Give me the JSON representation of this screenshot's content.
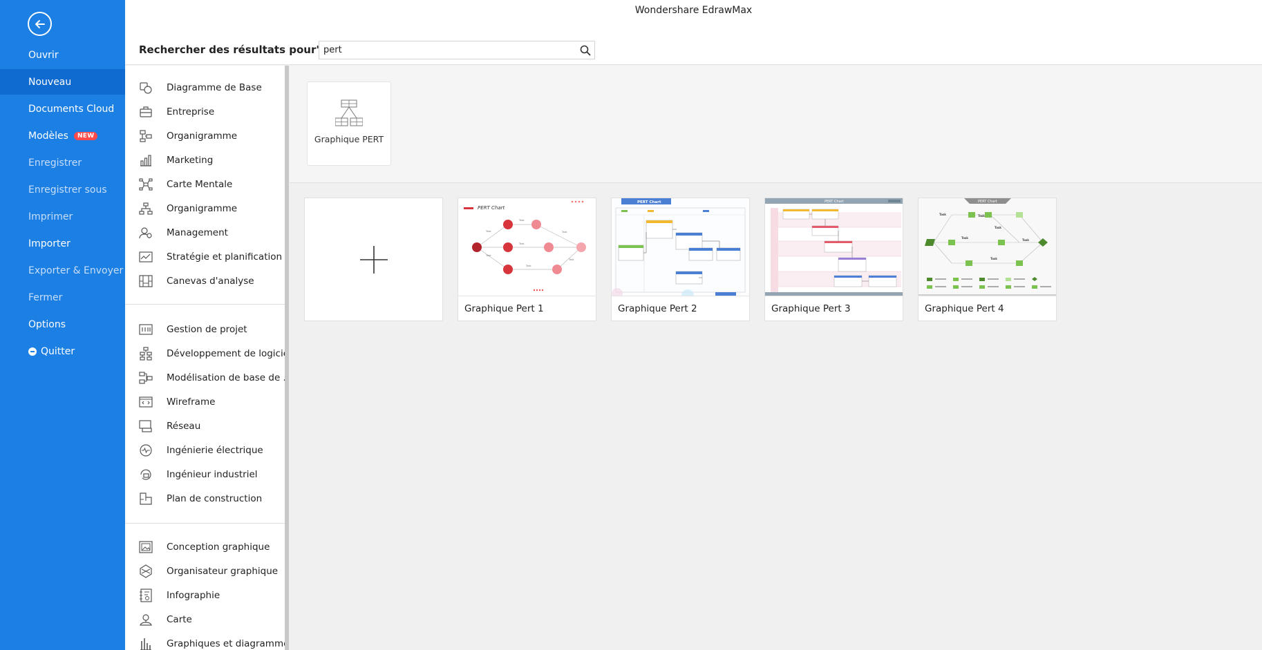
{
  "app": {
    "title": "Wondershare EdrawMax"
  },
  "sidebar": {
    "items": [
      {
        "label": "Ouvrir"
      },
      {
        "label": "Nouveau"
      },
      {
        "label": "Documents Cloud"
      },
      {
        "label": "Modèles",
        "badge": "NEW"
      },
      {
        "label": "Enregistrer"
      },
      {
        "label": "Enregistrer sous"
      },
      {
        "label": "Imprimer"
      },
      {
        "label": "Importer"
      },
      {
        "label": "Exporter & Envoyer"
      },
      {
        "label": "Fermer"
      },
      {
        "label": "Options"
      },
      {
        "label": "Quitter"
      }
    ],
    "active": "Nouveau",
    "colors": {
      "background": "#1b7fe3",
      "active": "#0f6bd0",
      "badge": "#ff4a4a"
    }
  },
  "search": {
    "label": "Rechercher des résultats pour\"pert\"",
    "value": "pert",
    "placeholder": ""
  },
  "categories": {
    "group1": [
      {
        "label": "Diagramme de Base",
        "icon": "basic-diagram-icon"
      },
      {
        "label": "Entreprise",
        "icon": "briefcase-icon"
      },
      {
        "label": "Organigramme",
        "icon": "flowchart-icon"
      },
      {
        "label": "Marketing",
        "icon": "bar-chart-icon"
      },
      {
        "label": "Carte Mentale",
        "icon": "mind-map-icon"
      },
      {
        "label": "Organigramme",
        "icon": "org-chart-icon"
      },
      {
        "label": "Management",
        "icon": "management-icon"
      },
      {
        "label": "Stratégie et planification",
        "icon": "strategy-icon"
      },
      {
        "label": "Canevas d'analyse",
        "icon": "canvas-icon"
      }
    ],
    "group2": [
      {
        "label": "Gestion de projet",
        "icon": "project-icon"
      },
      {
        "label": "Développement de logiciels",
        "icon": "software-icon"
      },
      {
        "label": "Modélisation de base de ...",
        "icon": "database-icon"
      },
      {
        "label": "Wireframe",
        "icon": "wireframe-icon"
      },
      {
        "label": "Réseau",
        "icon": "network-icon"
      },
      {
        "label": "Ingénierie électrique",
        "icon": "electric-icon"
      },
      {
        "label": "Ingénieur industriel",
        "icon": "industrial-icon"
      },
      {
        "label": "Plan de construction",
        "icon": "floorplan-icon"
      }
    ],
    "group3": [
      {
        "label": "Conception graphique",
        "icon": "graphic-design-icon"
      },
      {
        "label": "Organisateur graphique",
        "icon": "organizer-icon"
      },
      {
        "label": "Infographie",
        "icon": "infographic-icon"
      },
      {
        "label": "Carte",
        "icon": "map-pin-icon"
      },
      {
        "label": "Graphiques et diagrammes",
        "icon": "charts-icon"
      }
    ]
  },
  "diagram_type": {
    "label": "Graphique PERT"
  },
  "templates": [
    {
      "name": "Graphique Pert 1"
    },
    {
      "name": "Graphique Pert 2"
    },
    {
      "name": "Graphique Pert 3"
    },
    {
      "name": "Graphique Pert 4"
    }
  ],
  "thumbnails": {
    "pert1": {
      "title": "PERT Chart",
      "node_label": "Task",
      "accent": "#d8343c"
    },
    "pert2": {
      "title": "PERT Chart",
      "accent": "#4a7fd4"
    },
    "pert3": {
      "title": "PERT Chart",
      "accent": "#93a5b3"
    },
    "pert4": {
      "title": "PERT Chart",
      "node_label": "Task",
      "accent": "#7cc24e"
    }
  }
}
